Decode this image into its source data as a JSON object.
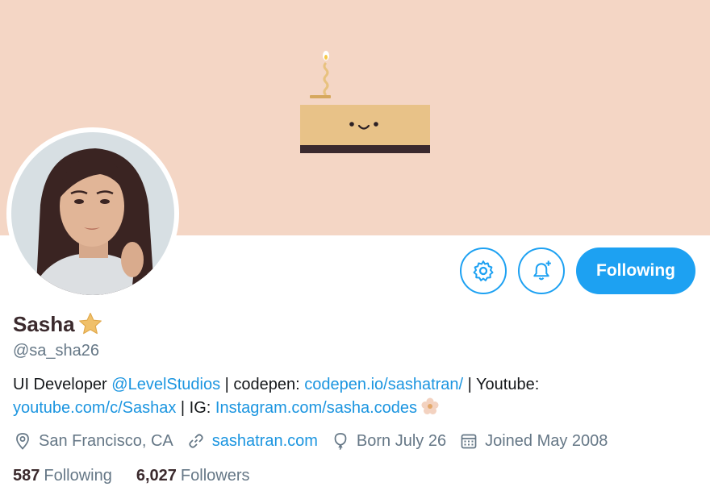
{
  "profile": {
    "name": "Sasha",
    "handle": "@sa_sha26",
    "banner_color": "#f4d6c5",
    "accent_color": "#1da1f2"
  },
  "actions": {
    "settings_icon": "gear-icon",
    "notify_icon": "bell-plus-icon",
    "follow_label": "Following"
  },
  "bio": {
    "t1": "UI Developer ",
    "l1": "@LevelStudios",
    "t2": " | codepen: ",
    "l2": "codepen.io/sashatran/",
    "t3": " | Youtube: ",
    "l3": "youtube.com/c/Sashax",
    "t4": " | IG: ",
    "l4": "Instagram.com/sasha.codes"
  },
  "meta": {
    "location": "San Francisco, CA",
    "website": "sashatran.com",
    "birthday": "Born July 26",
    "joined": "Joined May 2008"
  },
  "counts": {
    "following_value": "587",
    "following_label": "Following",
    "followers_value": "6,027",
    "followers_label": "Followers"
  }
}
